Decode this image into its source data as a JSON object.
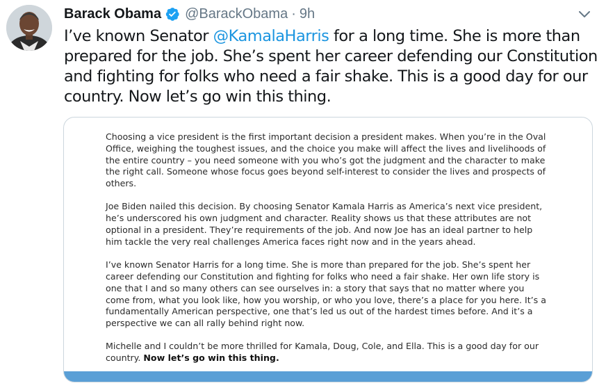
{
  "tweet": {
    "display_name": "Barack Obama",
    "handle": "@BarackObama",
    "separator": "·",
    "time": "9h",
    "text_before": "I’ve known Senator ",
    "mention": "@KamalaHarris",
    "text_after": " for a long time. She is more than prepared for the job. She’s spent her career defending our Constitution and fighting for folks who need a fair shake. This is a good day for our country. Now let’s go win this thing.",
    "icons": {
      "verified": "verified-badge-icon",
      "caret": "chevron-down-icon"
    },
    "colors": {
      "mention": "#1b95e0",
      "verified": "#1da1f2",
      "muted": "#657786",
      "card_bar": "#5a9fd6"
    }
  },
  "statement": {
    "paragraphs": [
      "Choosing a vice president is the first important decision a president makes. When you’re in the Oval Office, weighing the toughest issues, and the choice you make will affect the lives and livelihoods of the entire country – you need someone with you who’s got the judgment and the character to make the right call. Someone whose focus goes beyond self-interest to consider the lives and prospects of others.",
      "Joe Biden nailed this decision. By choosing Senator Kamala Harris as America’s next vice president, he’s underscored his own judgment and character. Reality shows us that these attributes are not optional in a president. They’re requirements of the job. And now Joe has an ideal partner to help him tackle the very real challenges America faces right now and in the years ahead.",
      "I’ve known Senator Harris for a long time. She is more than prepared for the job. She’s spent her career defending our Constitution and fighting for folks who need a fair shake. Her own life story is one that I and so many others can see ourselves in: a story that says that no matter where you come from, what you look like, how you worship, or who you love, there’s a place for you here. It’s a fundamentally American perspective, one that’s led us out of the hardest times before. And it’s a perspective we can all rally behind right now."
    ],
    "last_paragraph_text": "Michelle and I couldn’t be more thrilled for Kamala, Doug, Cole, and Ella. This is a good day for our country. ",
    "last_paragraph_bold": "Now let’s go win this thing."
  }
}
